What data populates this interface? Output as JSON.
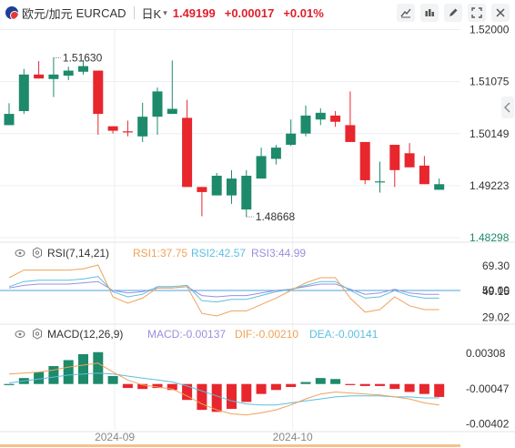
{
  "header": {
    "name": "欧元/加元",
    "symbol": "EURCAD",
    "period": "日K",
    "price": "1.49199",
    "change": "+0.00017",
    "change_pct": "+0.01%",
    "tool_icons": [
      "line-tool-icon",
      "indicator-tool-icon",
      "draw-tool-icon",
      "fullscreen-icon",
      "close-icon"
    ]
  },
  "colors": {
    "up": "#e8262d",
    "down": "#1d8a6b",
    "axis_text": "#333333",
    "grid": "#eceff3",
    "rsi1": "#f0a259",
    "rsi2": "#5cbfe0",
    "rsi3": "#9a8fdb",
    "dif": "#f0a259",
    "dea": "#5cbfe0"
  },
  "chart_data": [
    {
      "type": "candlestick",
      "yticks": [
        "1.52000",
        "1.51075",
        "1.50149",
        "1.49223",
        "1.48298"
      ],
      "ylim": [
        1.4825,
        1.5204
      ],
      "max_label": "1.51630",
      "min_label": "1.48668",
      "candles": [
        {
          "o": 1.503,
          "c": 1.505,
          "h": 1.5069,
          "l": 1.503,
          "dir": "up"
        },
        {
          "o": 1.5055,
          "c": 1.512,
          "h": 1.513,
          "l": 1.505,
          "dir": "up"
        },
        {
          "o": 1.512,
          "c": 1.5113,
          "h": 1.5144,
          "l": 1.5113,
          "dir": "down"
        },
        {
          "o": 1.5112,
          "c": 1.512,
          "h": 1.515,
          "l": 1.508,
          "dir": "up"
        },
        {
          "o": 1.5118,
          "c": 1.5127,
          "h": 1.5134,
          "l": 1.511,
          "dir": "up"
        },
        {
          "o": 1.5125,
          "c": 1.5135,
          "h": 1.5146,
          "l": 1.512,
          "dir": "up"
        },
        {
          "o": 1.5127,
          "c": 1.505,
          "h": 1.5127,
          "l": 1.5013,
          "dir": "down"
        },
        {
          "o": 1.5028,
          "c": 1.502,
          "h": 1.5028,
          "l": 1.5015,
          "dir": "down"
        },
        {
          "o": 1.5019,
          "c": 1.5017,
          "h": 1.5038,
          "l": 1.501,
          "dir": "down"
        },
        {
          "o": 1.501,
          "c": 1.5045,
          "h": 1.507,
          "l": 1.5,
          "dir": "up"
        },
        {
          "o": 1.5045,
          "c": 1.509,
          "h": 1.5097,
          "l": 1.5013,
          "dir": "up"
        },
        {
          "o": 1.505,
          "c": 1.5059,
          "h": 1.5145,
          "l": 1.505,
          "dir": "up"
        },
        {
          "o": 1.5043,
          "c": 1.492,
          "h": 1.5075,
          "l": 1.492,
          "dir": "down"
        },
        {
          "o": 1.492,
          "c": 1.4911,
          "h": 1.492,
          "l": 1.4868,
          "dir": "down"
        },
        {
          "o": 1.4905,
          "c": 1.494,
          "h": 1.4945,
          "l": 1.4905,
          "dir": "up"
        },
        {
          "o": 1.4905,
          "c": 1.4935,
          "h": 1.495,
          "l": 1.489,
          "dir": "up"
        },
        {
          "o": 1.488,
          "c": 1.494,
          "h": 1.495,
          "l": 1.4867,
          "dir": "up"
        },
        {
          "o": 1.4935,
          "c": 1.4975,
          "h": 1.499,
          "l": 1.4935,
          "dir": "up"
        },
        {
          "o": 1.497,
          "c": 1.499,
          "h": 1.4995,
          "l": 1.496,
          "dir": "up"
        },
        {
          "o": 1.4995,
          "c": 1.5015,
          "h": 1.504,
          "l": 1.4993,
          "dir": "up"
        },
        {
          "o": 1.5015,
          "c": 1.5047,
          "h": 1.5065,
          "l": 1.501,
          "dir": "up"
        },
        {
          "o": 1.504,
          "c": 1.5052,
          "h": 1.506,
          "l": 1.503,
          "dir": "up"
        },
        {
          "o": 1.5047,
          "c": 1.5036,
          "h": 1.5055,
          "l": 1.5027,
          "dir": "down"
        },
        {
          "o": 1.503,
          "c": 1.5,
          "h": 1.509,
          "l": 1.5,
          "dir": "down"
        },
        {
          "o": 1.5,
          "c": 1.4932,
          "h": 1.5,
          "l": 1.4925,
          "dir": "down"
        },
        {
          "o": 1.493,
          "c": 1.493,
          "h": 1.4965,
          "l": 1.491,
          "dir": "up"
        },
        {
          "o": 1.495,
          "c": 1.4995,
          "h": 1.4995,
          "l": 1.492,
          "dir": "down"
        },
        {
          "o": 1.498,
          "c": 1.4955,
          "h": 1.4998,
          "l": 1.4955,
          "dir": "down"
        },
        {
          "o": 1.4958,
          "c": 1.4925,
          "h": 1.4975,
          "l": 1.4925,
          "dir": "down"
        },
        {
          "o": 1.4925,
          "c": 1.4915,
          "h": 1.4935,
          "l": 1.4915,
          "dir": "up"
        }
      ],
      "x_labels": [
        {
          "label": "2024-09",
          "index": 7
        },
        {
          "label": "2024-10",
          "index": 19
        }
      ]
    },
    {
      "type": "line",
      "name": "RSI(7,14,21)",
      "series": [
        {
          "name": "RSI1:37.75",
          "key": "rsi1"
        },
        {
          "name": "RSI2:42.57",
          "key": "rsi2"
        },
        {
          "name": "RSI3:44.99",
          "key": "rsi3"
        }
      ],
      "yticks": [
        "69.30",
        "50.00",
        "49.15",
        "29.02"
      ],
      "ylim": [
        25,
        75
      ],
      "rsi1": [
        60,
        66,
        66,
        66,
        66,
        67,
        70,
        45,
        40,
        44,
        52,
        52,
        53,
        32,
        30,
        34,
        34,
        39,
        44,
        50,
        56,
        60,
        60,
        44,
        33,
        35,
        45,
        38,
        35,
        35
      ],
      "rsi2": [
        53,
        57,
        58,
        58,
        58,
        59,
        61,
        49,
        45,
        47,
        53,
        53,
        54,
        42,
        41,
        43,
        43,
        46,
        49,
        51,
        54,
        57,
        57,
        50,
        44,
        45,
        50,
        46,
        44,
        44
      ],
      "rsi3": [
        52,
        54,
        55,
        55,
        55,
        56,
        57,
        50,
        48,
        49,
        52,
        52,
        53,
        46,
        45,
        46,
        46,
        48,
        50,
        51,
        53,
        55,
        55,
        51,
        47,
        48,
        51,
        48,
        47,
        47
      ]
    },
    {
      "type": "bar",
      "name": "MACD(12,26,9)",
      "series": [
        {
          "name": "MACD:-0.00137",
          "key": "macd"
        },
        {
          "name": "DIF:-0.00210",
          "key": "dif"
        },
        {
          "name": "DEA:-0.00141",
          "key": "dea"
        }
      ],
      "yticks": [
        "0.00308",
        "-0.00047",
        "-0.00402"
      ],
      "ylim": [
        -0.0046,
        0.004
      ],
      "macd": [
        0.0,
        0.0006,
        0.0012,
        0.0018,
        0.0024,
        0.003,
        0.0032,
        0.0008,
        -0.0004,
        -0.0005,
        -0.0004,
        -0.0006,
        -0.0016,
        -0.0026,
        -0.0028,
        -0.0025,
        -0.0018,
        -0.001,
        -0.0006,
        -0.0003,
        0.0002,
        0.0006,
        0.0005,
        -0.0001,
        -0.0002,
        -0.0002,
        -0.0005,
        -0.0008,
        -0.001,
        -0.0013
      ],
      "dif": [
        0.001,
        0.0011,
        0.0012,
        0.0014,
        0.0017,
        0.0019,
        0.0021,
        0.0012,
        0.0004,
        -0.0001,
        -0.0003,
        -0.0005,
        -0.0012,
        -0.002,
        -0.0026,
        -0.003,
        -0.0031,
        -0.0029,
        -0.0026,
        -0.0021,
        -0.0015,
        -0.001,
        -0.0008,
        -0.0009,
        -0.001,
        -0.0011,
        -0.0013,
        -0.0015,
        -0.0019,
        -0.0021
      ],
      "dea": [
        0.0001,
        0.0003,
        0.0005,
        0.0007,
        0.0009,
        0.001,
        0.0011,
        0.001,
        0.0008,
        0.0006,
        0.0004,
        0.0002,
        -0.0002,
        -0.0007,
        -0.0012,
        -0.0017,
        -0.002,
        -0.0021,
        -0.0021,
        -0.0019,
        -0.0017,
        -0.0015,
        -0.0013,
        -0.0012,
        -0.0012,
        -0.0012,
        -0.0013,
        -0.0013,
        -0.0014,
        -0.0014
      ]
    }
  ]
}
